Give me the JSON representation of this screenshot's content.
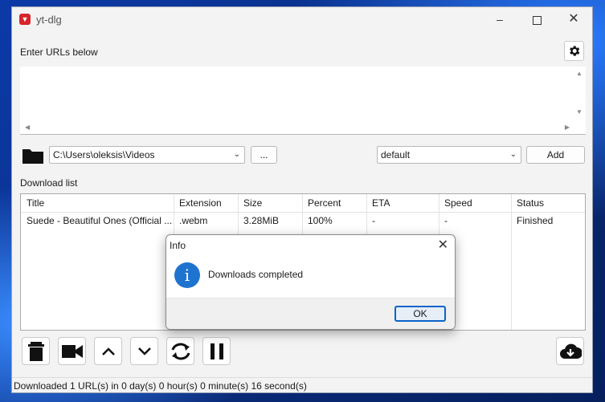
{
  "window": {
    "title": "yt-dlg"
  },
  "urls": {
    "label": "Enter URLs below",
    "value": ""
  },
  "path": {
    "value": "C:\\Users\\oleksis\\Videos",
    "browse_label": "..."
  },
  "format": {
    "value": "default",
    "add_label": "Add"
  },
  "download_list": {
    "label": "Download list",
    "columns": [
      "Title",
      "Extension",
      "Size",
      "Percent",
      "ETA",
      "Speed",
      "Status"
    ],
    "rows": [
      {
        "title": "Suede - Beautiful Ones (Official ...",
        "extension": ".webm",
        "size": "3.28MiB",
        "percent": "100%",
        "eta": "-",
        "speed": "-",
        "status": "Finished"
      }
    ]
  },
  "status_bar": {
    "text": "Downloaded 1 URL(s) in 0 day(s) 0 hour(s) 0 minute(s) 16 second(s)"
  },
  "dialog": {
    "title": "Info",
    "message": "Downloads completed",
    "ok_label": "OK"
  },
  "colors": {
    "accent": "#0a64c8",
    "info_icon": "#1e73cf",
    "app_icon": "#d6262b"
  },
  "icons": {
    "toolbar": [
      "trash-icon",
      "video-camera-icon",
      "arrow-up-icon",
      "arrow-down-icon",
      "reload-icon",
      "pause-icon",
      "download-cloud-icon"
    ]
  }
}
